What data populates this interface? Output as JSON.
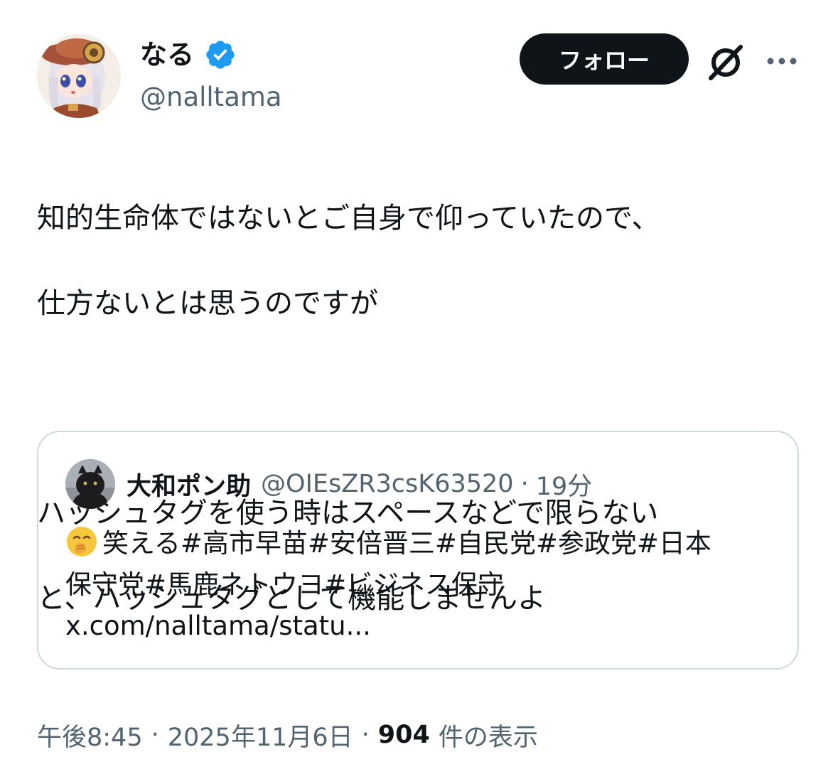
{
  "author": {
    "name": "なる",
    "handle": "@nalltama",
    "verified": true
  },
  "header": {
    "follow_label": "フォロー",
    "grok_icon": "grok-icon",
    "more_icon": "more-options-icon"
  },
  "tweet": {
    "lines": [
      "知的生命体ではないとご自身で仰っていたので、",
      "仕方ないとは思うのですが",
      "ハッシュタグを使う時はスペースなどで限らない",
      "と、ハッシュタグとして機能しませんよ"
    ]
  },
  "quote": {
    "name": "大和ポン助",
    "handle": "@OIEsZR3csK63520",
    "separator": "·",
    "time": "19分",
    "emoji": "face-with-hand-over-mouth-icon",
    "lines": [
      "笑える#高市早苗#安倍晋三#自民党#参政党#日本",
      "保守党#馬鹿ネトウヨ#ビジネス保守",
      "x.com/nalltama/statu..."
    ]
  },
  "meta": {
    "time": "午後8:45",
    "separator": "·",
    "date": "2025年11月6日",
    "views": "904",
    "views_label": "件の表示"
  },
  "colors": {
    "text_primary": "#0f1419",
    "text_secondary": "#536471",
    "verified_blue": "#1d9bf0",
    "border": "#cfd9de",
    "follow_bg": "#0f1419"
  }
}
